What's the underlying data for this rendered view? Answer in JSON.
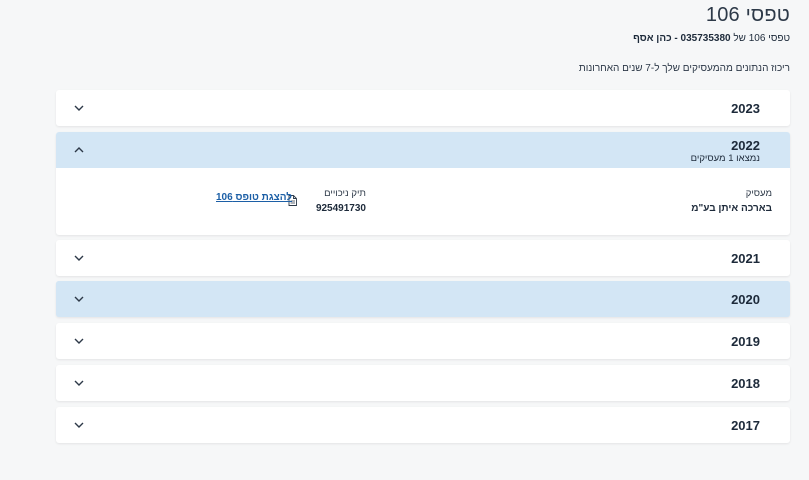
{
  "header": {
    "title": "טפסי 106",
    "subtitle_prefix": "טפסי 106 של",
    "id_number": "035735380",
    "name": "- כהן אסף",
    "summary": "ריכוז הנתונים מהמעסיקים שלך ל-7 שנים האחרונות"
  },
  "years": [
    {
      "year": "2023",
      "state": "collapsed"
    },
    {
      "year": "2022",
      "state": "expanded",
      "count_text": "נמצאו 1 מעסיקים",
      "employer_label": "מעסיק",
      "employer_value": "בארכה איתן בע\"מ",
      "file_label": "תיק ניכויים",
      "file_value": "925491730",
      "link_label": "להצגת טופס 106"
    },
    {
      "year": "2021",
      "state": "collapsed"
    },
    {
      "year": "2020",
      "state": "collapsed-highlighted"
    },
    {
      "year": "2019",
      "state": "collapsed"
    },
    {
      "year": "2018",
      "state": "collapsed"
    },
    {
      "year": "2017",
      "state": "collapsed"
    }
  ],
  "icons": {
    "expand": "chevron-down-icon",
    "collapse": "chevron-up-icon",
    "document": "document-icon"
  },
  "colors": {
    "active_header": "#d3e6f5",
    "link": "#1c5fa6",
    "background": "#f6f7f8"
  }
}
